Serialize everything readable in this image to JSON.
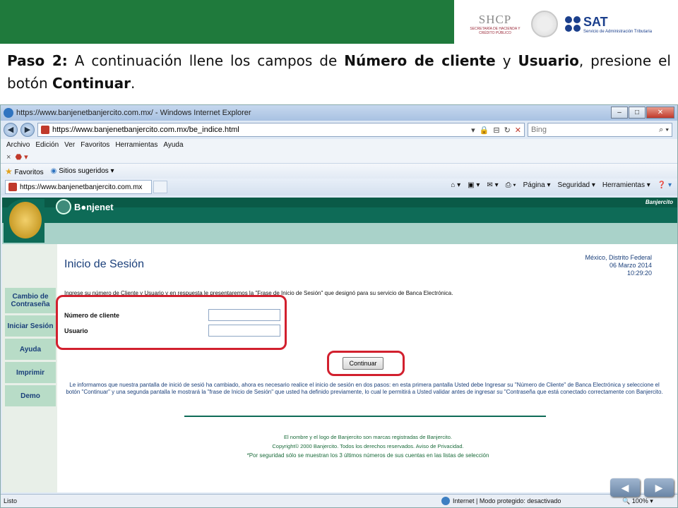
{
  "slide": {
    "instruction_parts": [
      "Paso 2:",
      " A continuación llene los campos de ",
      "Número de cliente",
      " y ",
      "Usuario",
      ", presione el botón ",
      "Continuar",
      "."
    ],
    "logos": {
      "shcp": "SHCP",
      "shcp_sub": "SECRETARÍA DE HACIENDA Y CRÉDITO PÚBLICO",
      "sat": "SAT",
      "sat_sub": "Servicio de Administración Tributaria"
    },
    "colors": {
      "banner": "#1f7a3c",
      "highlight": "#d2202e"
    }
  },
  "browser": {
    "window_title": "https://www.banjenetbanjercito.com.mx/ - Windows Internet Explorer",
    "address": "https://www.banjenetbanjercito.com.mx/be_indice.html",
    "search_placeholder": "Bing",
    "menu": [
      "Archivo",
      "Edición",
      "Ver",
      "Favoritos",
      "Herramientas",
      "Ayuda"
    ],
    "favorites_label": "Favoritos",
    "suggested_sites": "Sitios sugeridos ▾",
    "tab_title": "https://www.banjenetbanjercito.com.mx",
    "commands": [
      "Página ▾",
      "Seguridad ▾",
      "Herramientas ▾"
    ],
    "status_left": "Listo",
    "status_zone": "Internet | Modo protegido: desactivado",
    "zoom": "100%"
  },
  "page": {
    "brand": "B●njenet",
    "brand_right": "Banjercito",
    "sidenav": [
      "Cambio de Contraseña",
      "Iniciar Sesión",
      "Ayuda",
      "Imprimir",
      "Demo"
    ],
    "login_title": "Inicio de Sesión",
    "date_lines": [
      "México, Distrito Federal",
      "06 Marzo 2014",
      "10:29:20"
    ],
    "prompt": "Ingrese su número de Cliente y Usuario y en respuesta le presentaremos la \"Frase de Inicio de Sesión\" que designó para su servicio de Banca Electrónica.",
    "client_label": "Número de cliente",
    "user_label": "Usuario",
    "client_value": "",
    "user_value": "",
    "continue_button": "Continuar",
    "info": "Le informamos que nuestra pantalla de inició de sesió ha cambiado, ahora es necesario realice el inicio de sesión en dos pasos: en esta primera pantalla Usted debe Ingresar su \"Número de Cliente\" de Banca Electrónica y seleccione el botón \"Continuar\" y una segunda pantalla le mostrará la \"frase de Inicio de Sesión\" que usted ha definido previamente, lo cual le permitirá a Usted validar antes de ingresar su \"Contraseña que está conectado correctamente con Banjercito.",
    "footer": [
      "El nombre y el logo de Banjercito son marcas registradas de Banjercito.",
      "Copyright© 2000 Banjercito. Todos los derechos reservados. Aviso de Privacidad.",
      "*Por seguridad sólo se muestran los 3 últimos números de sus cuentas en las listas de selección"
    ]
  }
}
